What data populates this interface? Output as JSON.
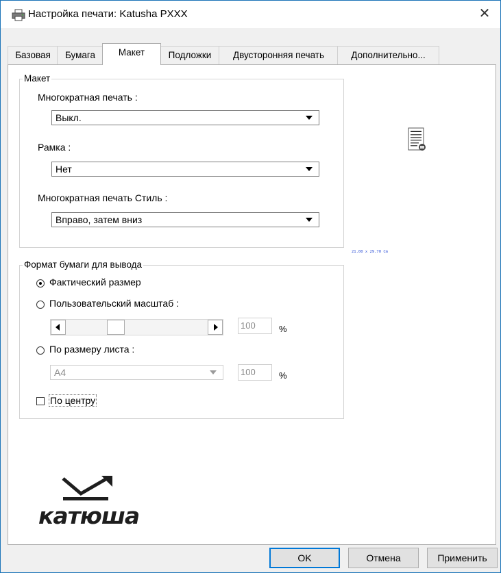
{
  "window": {
    "title": "Настройка печати: Katusha PXXX",
    "close_icon": "close-icon",
    "title_icon": "printer-icon"
  },
  "tabs": [
    {
      "label": "Базовая",
      "active": false
    },
    {
      "label": "Бумага",
      "active": false
    },
    {
      "label": "Макет",
      "active": true
    },
    {
      "label": "Подложки",
      "active": false
    },
    {
      "label": "Двусторонняя печать",
      "active": false
    },
    {
      "label": "Дополнительно...",
      "active": false
    }
  ],
  "layout_group": {
    "legend": "Макет",
    "multi_print_label": "Многократная печать :",
    "multi_print_value": "Выкл.",
    "frame_label": "Рамка :",
    "frame_value": "Нет",
    "style_label": "Многократная печать Стиль :",
    "style_value": "Вправо, затем вниз"
  },
  "preview": {
    "icon": "page-preview-icon",
    "size_text": "21.00 x 29.70 Cm"
  },
  "output_group": {
    "legend": "Формат бумаги для вывода",
    "actual_size_label": "Фактический размер",
    "actual_size_checked": true,
    "custom_scale_label": "Пользовательский масштаб :",
    "custom_scale_checked": false,
    "custom_scale_value": "100",
    "percent_sign": "%",
    "fit_to_page_label": "По размеру листа :",
    "fit_to_page_checked": false,
    "paper_value": "A4",
    "fit_percent_value": "100",
    "center_label": "По центру",
    "center_checked": false
  },
  "logo": {
    "text": "катюша",
    "icon": "katusha-logo"
  },
  "buttons": {
    "ok": "OK",
    "cancel": "Отмена",
    "apply": "Применить"
  },
  "colors": {
    "accent": "#0078d7",
    "size_text": "#2a4dd6"
  }
}
